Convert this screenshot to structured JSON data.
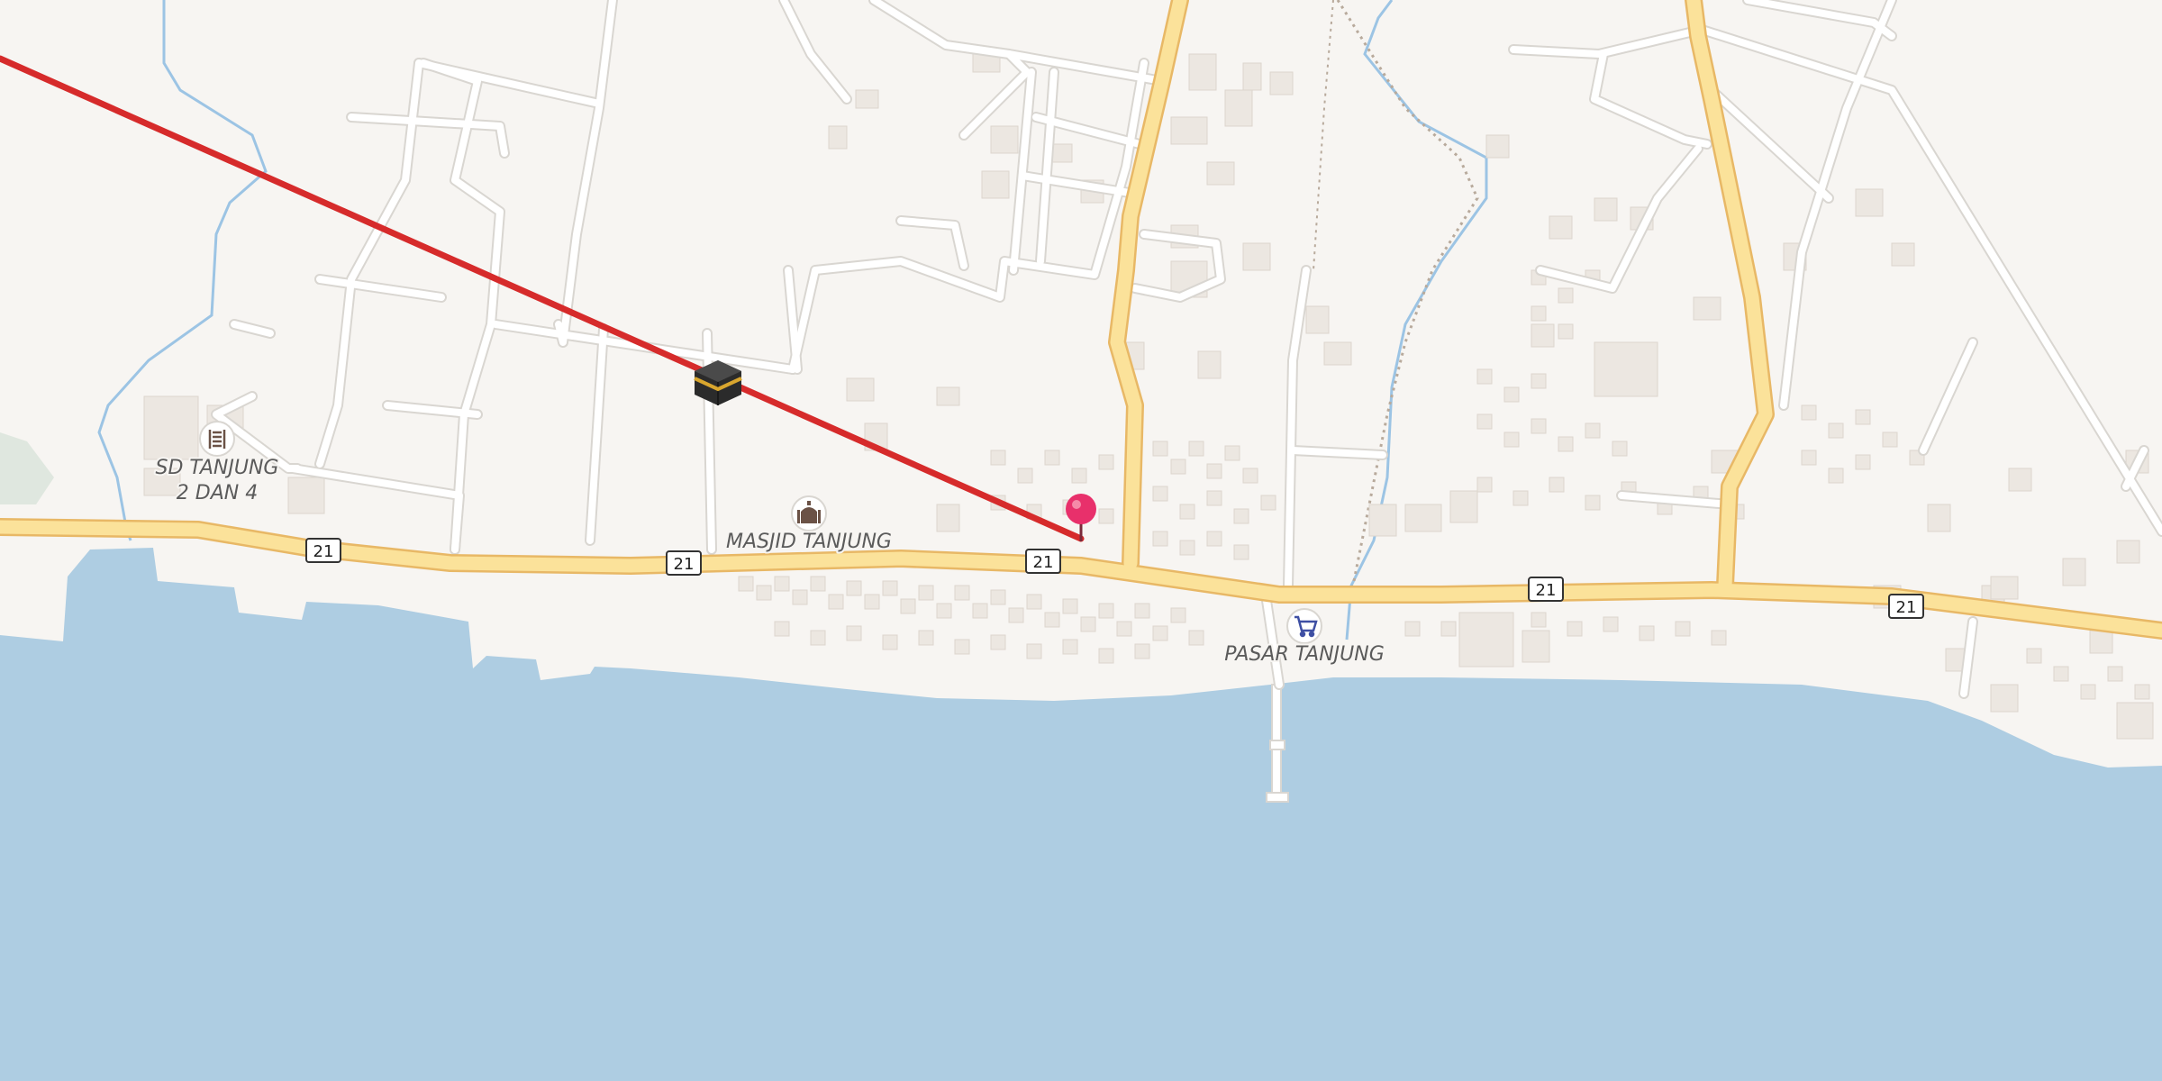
{
  "map": {
    "colors": {
      "land": "#f7f5f2",
      "water": "#aecde2",
      "major_road": "#fbe29a",
      "major_road_casing": "#e8b866",
      "minor_road": "#ffffff",
      "minor_road_casing": "#d9d6d1",
      "building": "#ece7e1",
      "stream": "#9cc4e4",
      "qibla_line": "#d62b2b",
      "pin": "#e8306b"
    },
    "route_shields": [
      {
        "label": "21"
      },
      {
        "label": "21"
      },
      {
        "label": "21"
      },
      {
        "label": "21"
      },
      {
        "label": "21"
      }
    ],
    "pois": [
      {
        "icon": "school-icon",
        "label_line1": "SD TANJUNG",
        "label_line2": "2 DAN 4"
      },
      {
        "icon": "mosque-icon",
        "label": "MASJID TANJUNG"
      },
      {
        "icon": "shopping-cart-icon",
        "label": "PASAR TANJUNG"
      }
    ],
    "markers": [
      {
        "icon": "kaaba-icon",
        "meaning": "qibla direction"
      },
      {
        "icon": "location-pin-icon"
      }
    ]
  }
}
